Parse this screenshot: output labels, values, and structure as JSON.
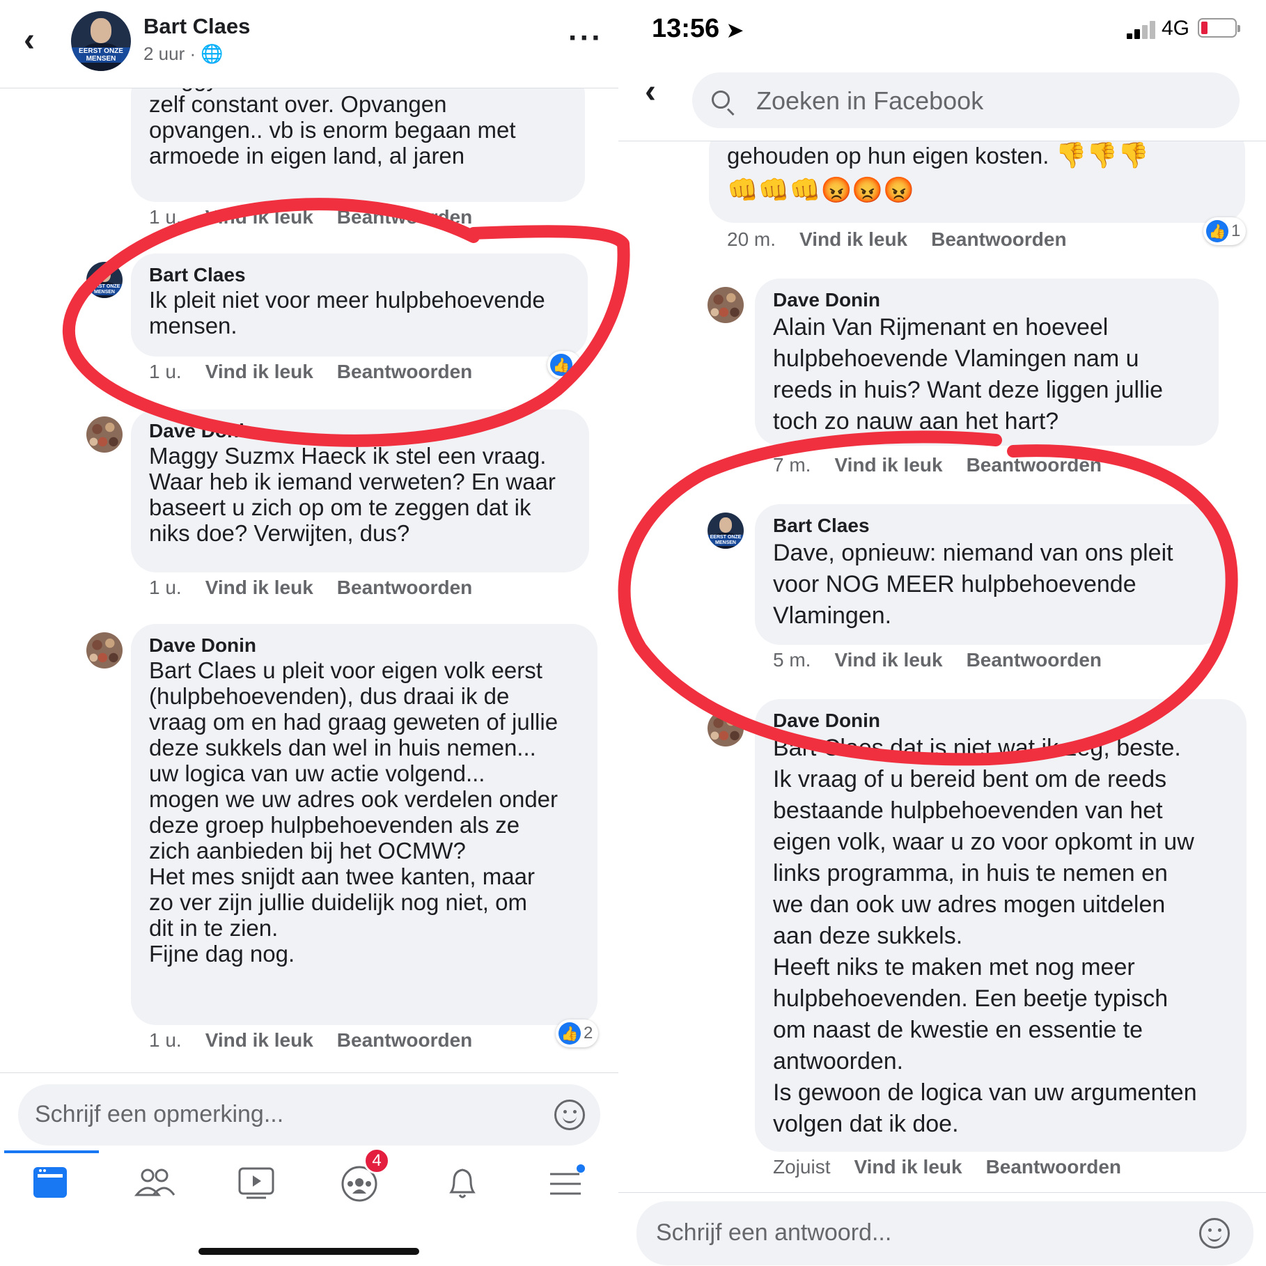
{
  "left": {
    "header": {
      "title": "Bart Claes",
      "subtitle": "2 uur ·"
    },
    "comments": [
      {
        "author": "",
        "text": "Maggy Suzmx Haeck ze hebben het er\nzelf constant over. Opvangen\nopvangen.. vb is enorm begaan met\narmoede in eigen land, al jaren",
        "time": "1 u.",
        "like": "Vind ik leuk",
        "reply": "Beantwoorden"
      },
      {
        "author": "Bart Claes",
        "text": "Ik pleit niet voor meer hulpbehoevende\nmensen.",
        "time": "1 u.",
        "like": "Vind ik leuk",
        "reply": "Beantwoorden"
      },
      {
        "author": "Dave Donin",
        "text": "Maggy Suzmx Haeck ik stel een vraag.\nWaar heb ik iemand verweten? En waar\nbaseert u zich op om te zeggen dat ik\nniks doe? Verwijten, dus?",
        "time": "1 u.",
        "like": "Vind ik leuk",
        "reply": "Beantwoorden"
      },
      {
        "author": "Dave Donin",
        "text": "Bart Claes u pleit voor eigen volk eerst\n(hulpbehoevenden), dus draai ik de\nvraag om en had graag geweten of jullie\ndeze sukkels dan wel in huis nemen...\nuw logica van uw actie volgend...\nmogen we uw adres ook verdelen onder\ndeze groep hulpbehoevenden als ze\nzich aanbieden bij het OCMW?\nHet mes snijdt aan twee kanten, maar\nzo ver zijn jullie duidelijk nog niet, om\ndit in te zien.\nFijne dag nog.",
        "time": "1 u.",
        "like": "Vind ik leuk",
        "reply": "Beantwoorden",
        "reactions": "2"
      }
    ],
    "composer_placeholder": "Schrijf een opmerking...",
    "tab_badge_count": "4",
    "avatar_band": "EERST ONZE MENSEN"
  },
  "right": {
    "status": {
      "time": "13:56",
      "network": "4G"
    },
    "search_placeholder": "Zoeken in Facebook",
    "comments": [
      {
        "author": "",
        "text": "gehouden op hun eigen kosten.",
        "emojis": "👎👎👎\n👊👊👊😡😡😡",
        "time": "20 m.",
        "like": "Vind ik leuk",
        "reply": "Beantwoorden",
        "reactions": "1"
      },
      {
        "author": "Dave Donin",
        "text": "Alain Van Rijmenant en hoeveel\nhulpbehoevende Vlamingen nam u\nreeds in huis? Want deze liggen jullie\ntoch zo nauw aan het hart?",
        "time": "7 m.",
        "like": "Vind ik leuk",
        "reply": "Beantwoorden"
      },
      {
        "author": "Bart Claes",
        "text": "Dave, opnieuw: niemand van ons pleit\nvoor NOG MEER hulpbehoevende\nVlamingen.",
        "time": "5 m.",
        "like": "Vind ik leuk",
        "reply": "Beantwoorden"
      },
      {
        "author": "Dave Donin",
        "text": "Bart Claes dat is niet wat ik zeg, beste.\nIk vraag of u bereid bent om de reeds\nbestaande hulpbehoevenden van het\neigen volk, waar u zo voor opkomt in uw\nlinks programma, in huis te nemen en\nwe dan ook uw adres mogen uitdelen\naan deze sukkels.\nHeeft niks te maken met nog meer\nhulpbehoevenden. Een beetje typisch\nom naast de kwestie en essentie te\nantwoorden.\nIs gewoon de logica van uw argumenten\nvolgen dat ik doe.",
        "time": "Zojuist",
        "like": "Vind ik leuk",
        "reply": "Beantwoorden"
      }
    ],
    "composer_placeholder": "Schrijf een antwoord..."
  },
  "colors": {
    "accent": "#1877f2",
    "annotation": "#f0303f",
    "bubble": "#f0f2f5",
    "badge": "#e41e3f"
  }
}
